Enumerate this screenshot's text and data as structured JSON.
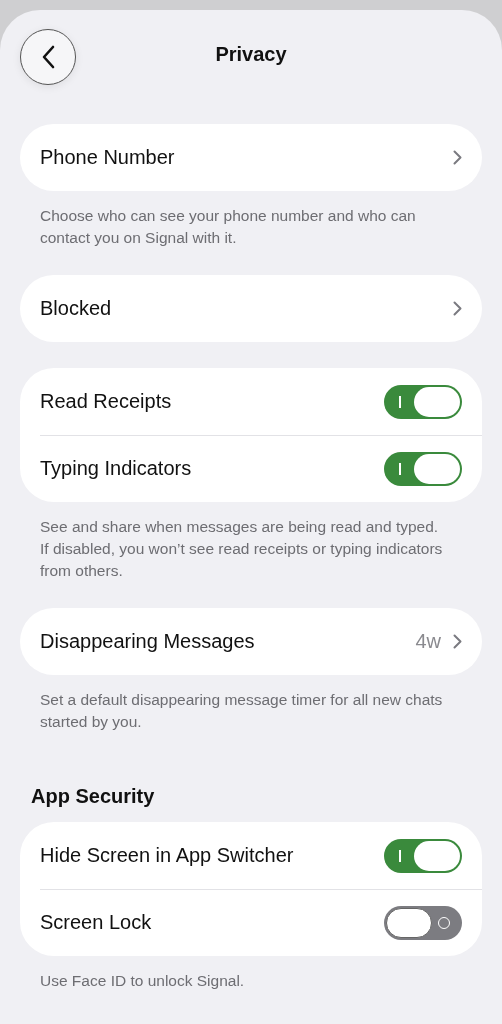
{
  "header": {
    "title": "Privacy"
  },
  "sections": [
    {
      "rows": [
        {
          "kind": "link",
          "label": "Phone Number"
        }
      ],
      "footer": "Choose who can see your phone number and who can contact you on Signal with it."
    },
    {
      "rows": [
        {
          "kind": "link",
          "label": "Blocked"
        }
      ]
    },
    {
      "rows": [
        {
          "kind": "toggle",
          "label": "Read Receipts",
          "on": true
        },
        {
          "kind": "toggle",
          "label": "Typing Indicators",
          "on": true
        }
      ],
      "footer": "See and share when messages are being read and typed. If disabled, you won’t see read receipts or typing indicators from others."
    },
    {
      "rows": [
        {
          "kind": "link",
          "label": "Disappearing Messages",
          "value": "4w"
        }
      ],
      "footer": "Set a default disappearing message timer for all new chats started by you."
    },
    {
      "header": "App Security",
      "rows": [
        {
          "kind": "toggle",
          "label": "Hide Screen in App Switcher",
          "on": true
        },
        {
          "kind": "toggle",
          "label": "Screen Lock",
          "on": false
        }
      ],
      "footer": "Use Face ID to unlock Signal."
    }
  ]
}
